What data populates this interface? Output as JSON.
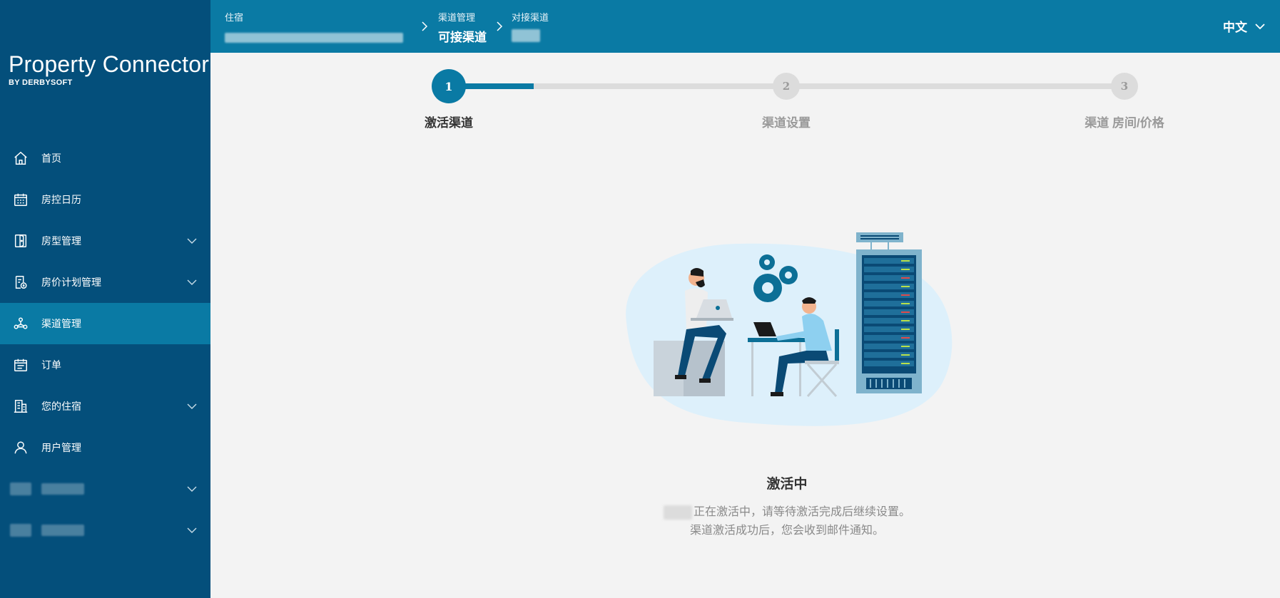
{
  "brand": {
    "name": "Property Connector",
    "sub": "BY DERBYSOFT"
  },
  "nav": {
    "items": [
      {
        "label": "首页",
        "icon": "home-icon"
      },
      {
        "label": "房控日历",
        "icon": "calendar-icon"
      },
      {
        "label": "房型管理",
        "icon": "door-icon",
        "expandable": true
      },
      {
        "label": "房价计划管理",
        "icon": "rate-plan-icon",
        "expandable": true
      },
      {
        "label": "渠道管理",
        "icon": "channel-icon",
        "active": true
      },
      {
        "label": "订单",
        "icon": "order-icon"
      },
      {
        "label": "您的住宿",
        "icon": "building-icon",
        "expandable": true
      },
      {
        "label": "用户管理",
        "icon": "user-icon"
      }
    ]
  },
  "breadcrumb": {
    "first": {
      "top": "住宿"
    },
    "second": {
      "top": "渠道管理",
      "bottom": "可接渠道"
    },
    "third": {
      "top": "对接渠道"
    }
  },
  "language": {
    "label": "中文"
  },
  "stepper": {
    "steps": [
      {
        "number": "1",
        "label": "激活渠道",
        "state": "active"
      },
      {
        "number": "2",
        "label": "渠道设置",
        "state": "idle"
      },
      {
        "number": "3",
        "label": "渠道 房间/价格",
        "state": "idle"
      }
    ],
    "progress": 0.2
  },
  "status": {
    "title": "激活中",
    "line1": "正在激活中，请等待激活完成后继续设置。",
    "line2": "渠道激活成功后，您会收到邮件通知。"
  },
  "colors": {
    "sidebar": "#044f7b",
    "accent": "#0a7aa4",
    "track": "#dcdcdc"
  }
}
